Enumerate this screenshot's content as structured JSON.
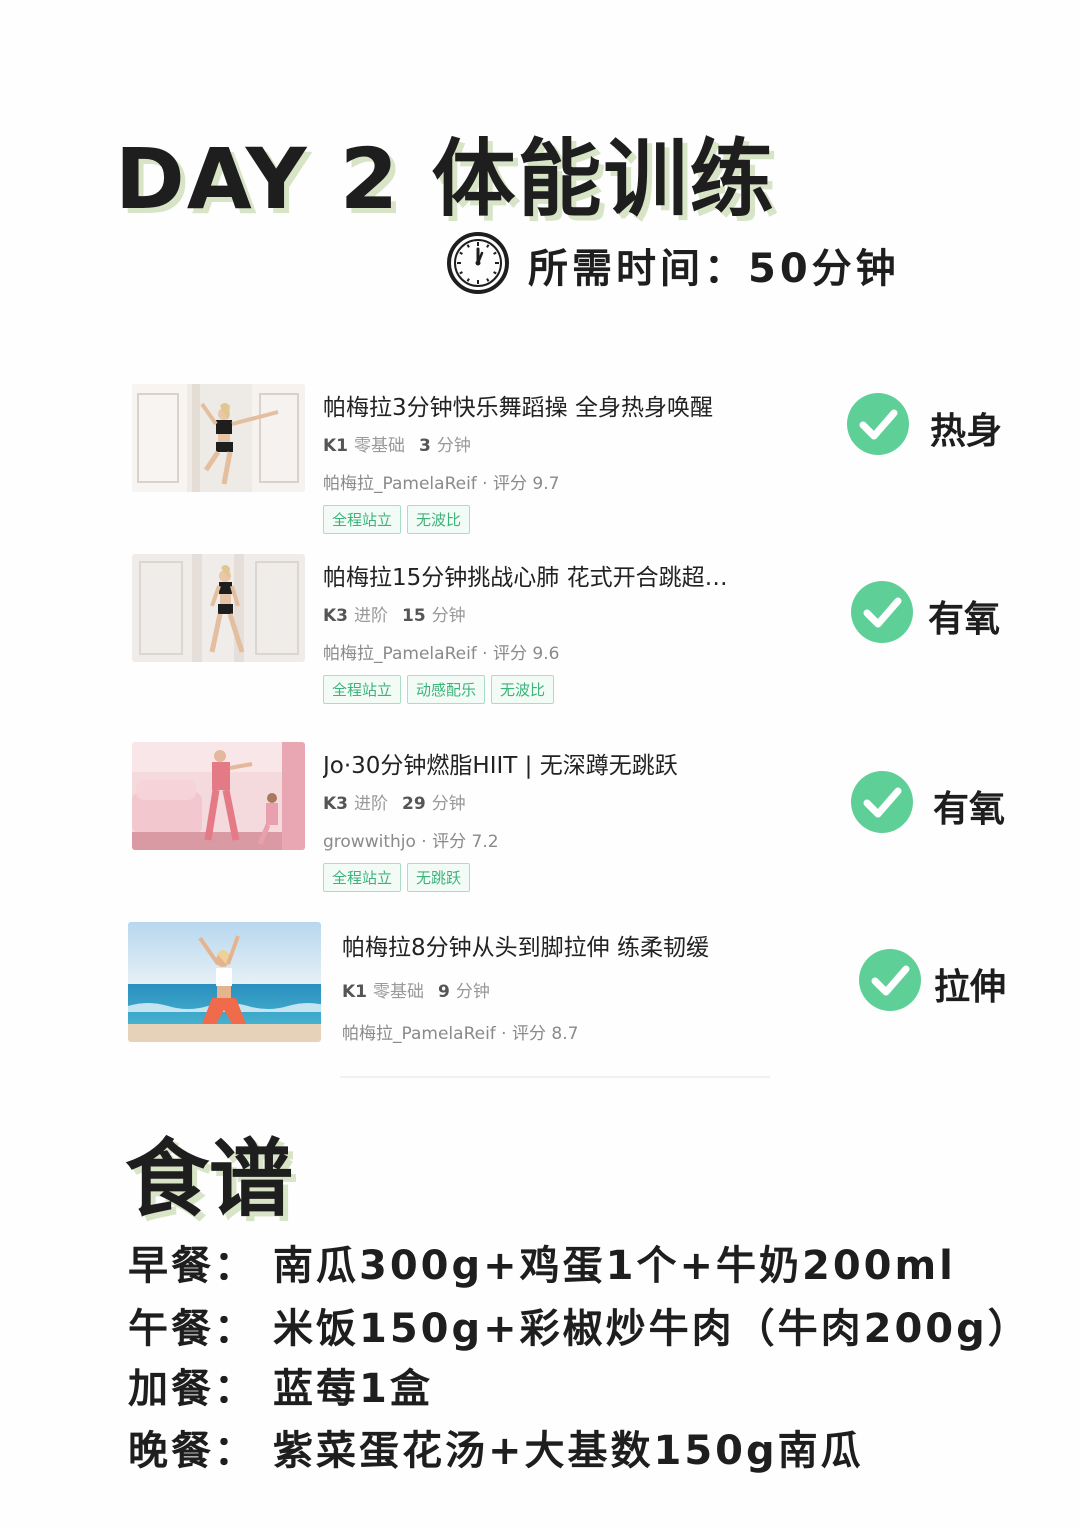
{
  "header": {
    "title": "DAY 2 体能训练",
    "time_label": "所需时间：",
    "time_value": "50分钟"
  },
  "videos": [
    {
      "title": "帕梅拉3分钟快乐舞蹈操 全身热身唤醒",
      "level": "K1",
      "level_name": "零基础",
      "minutes": "3",
      "minutes_unit": "分钟",
      "author": "帕梅拉_PamelaReif · 评分 9.7",
      "tags": [
        "全程站立",
        "无波比"
      ],
      "phase": "热身"
    },
    {
      "title": "帕梅拉15分钟挑战心肺 花式开合跳超…",
      "level": "K3",
      "level_name": "进阶",
      "minutes": "15",
      "minutes_unit": "分钟",
      "author": "帕梅拉_PamelaReif · 评分 9.6",
      "tags": [
        "全程站立",
        "动感配乐",
        "无波比"
      ],
      "phase": "有氧"
    },
    {
      "title": "Jo·30分钟燃脂HIIT | 无深蹲无跳跃",
      "level": "K3",
      "level_name": "进阶",
      "minutes": "29",
      "minutes_unit": "分钟",
      "author": "growwithjo · 评分 7.2",
      "tags": [
        "全程站立",
        "无跳跃"
      ],
      "phase": "有氧"
    },
    {
      "title": "帕梅拉8分钟从头到脚拉伸 练柔韧缓",
      "level": "K1",
      "level_name": "零基础",
      "minutes": "9",
      "minutes_unit": "分钟",
      "author": "帕梅拉_PamelaReif · 评分 8.7",
      "tags": [],
      "phase": "拉伸"
    }
  ],
  "recipe": {
    "title": "食谱",
    "meals": [
      {
        "label": "早餐：",
        "content": "南瓜300g+鸡蛋1个+牛奶200ml"
      },
      {
        "label": "午餐：",
        "content": "米饭150g+彩椒炒牛肉（牛肉200g）"
      },
      {
        "label": "加餐：",
        "content": "蓝莓1盒"
      },
      {
        "label": "晚餐：",
        "content": "紫菜蛋花汤+大基数150g南瓜"
      }
    ]
  },
  "colors": {
    "check_green": "#5fcf98",
    "title_shadow": "#d7e4c6",
    "tag_green": "#3db37a"
  },
  "icons": [
    "clock-icon",
    "check-circle-icon"
  ]
}
